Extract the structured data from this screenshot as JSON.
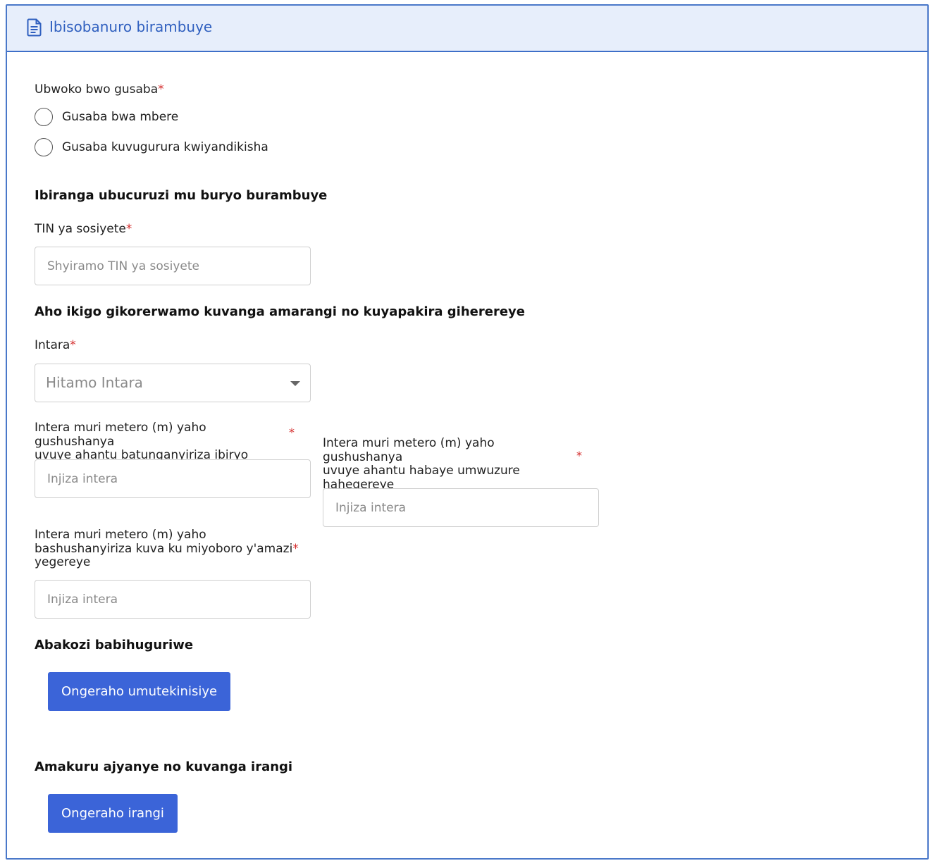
{
  "header": {
    "title": "Ibisobanuro birambuye",
    "icon": "document-icon"
  },
  "application_type": {
    "label": "Ubwoko bwo gusaba",
    "required_mark": "*",
    "options": [
      {
        "label": "Gusaba bwa mbere",
        "selected": false
      },
      {
        "label": "Gusaba kuvugurura kwiyandikisha",
        "selected": false
      }
    ]
  },
  "business_section": {
    "heading": "Ibiranga ubucuruzi mu buryo burambuye",
    "tin": {
      "label": "TIN ya sosiyete",
      "required_mark": "*",
      "placeholder": "Shyiramo TIN ya sosiyete",
      "value": ""
    }
  },
  "location_section": {
    "heading": "Aho ikigo gikorerwamo kuvanga amarangi no kuyapakira giherereye",
    "province": {
      "label": "Intara",
      "required_mark": "*",
      "selected": "Hitamo Intara"
    },
    "distance_food": {
      "label_line1": "Intera muri metero (m) yaho gushushanya",
      "label_line2": "uvuye ahantu batunganyiriza ibiryo",
      "required_mark": "*",
      "placeholder": "Injiza intera"
    },
    "distance_residence": {
      "label_line1": "Intera muri metero (m) yaho gushushanya",
      "label_line2": "uvuye ahantu habaye umwuzure",
      "label_line3": "hahegereye",
      "required_mark": "*",
      "placeholder": "Injiza intera"
    },
    "distance_water": {
      "label_line1": "Intera muri metero (m) yaho",
      "label_line2": "bashushanyiriza kuva ku miyoboro y'amazi",
      "label_line3": "yegereye",
      "required_mark": "*",
      "placeholder": "Injiza intera"
    }
  },
  "staff_section": {
    "heading": "Abakozi babihuguriwe",
    "add_button": "Ongeraho umutekinisiye"
  },
  "paint_section": {
    "heading": "Amakuru ajyanye no kuvanga irangi",
    "add_button": "Ongeraho irangi"
  },
  "colors": {
    "accent": "#3b64d8",
    "header_bg": "#e7eefb",
    "border": "#4a78c9",
    "required": "#d42c2c"
  }
}
